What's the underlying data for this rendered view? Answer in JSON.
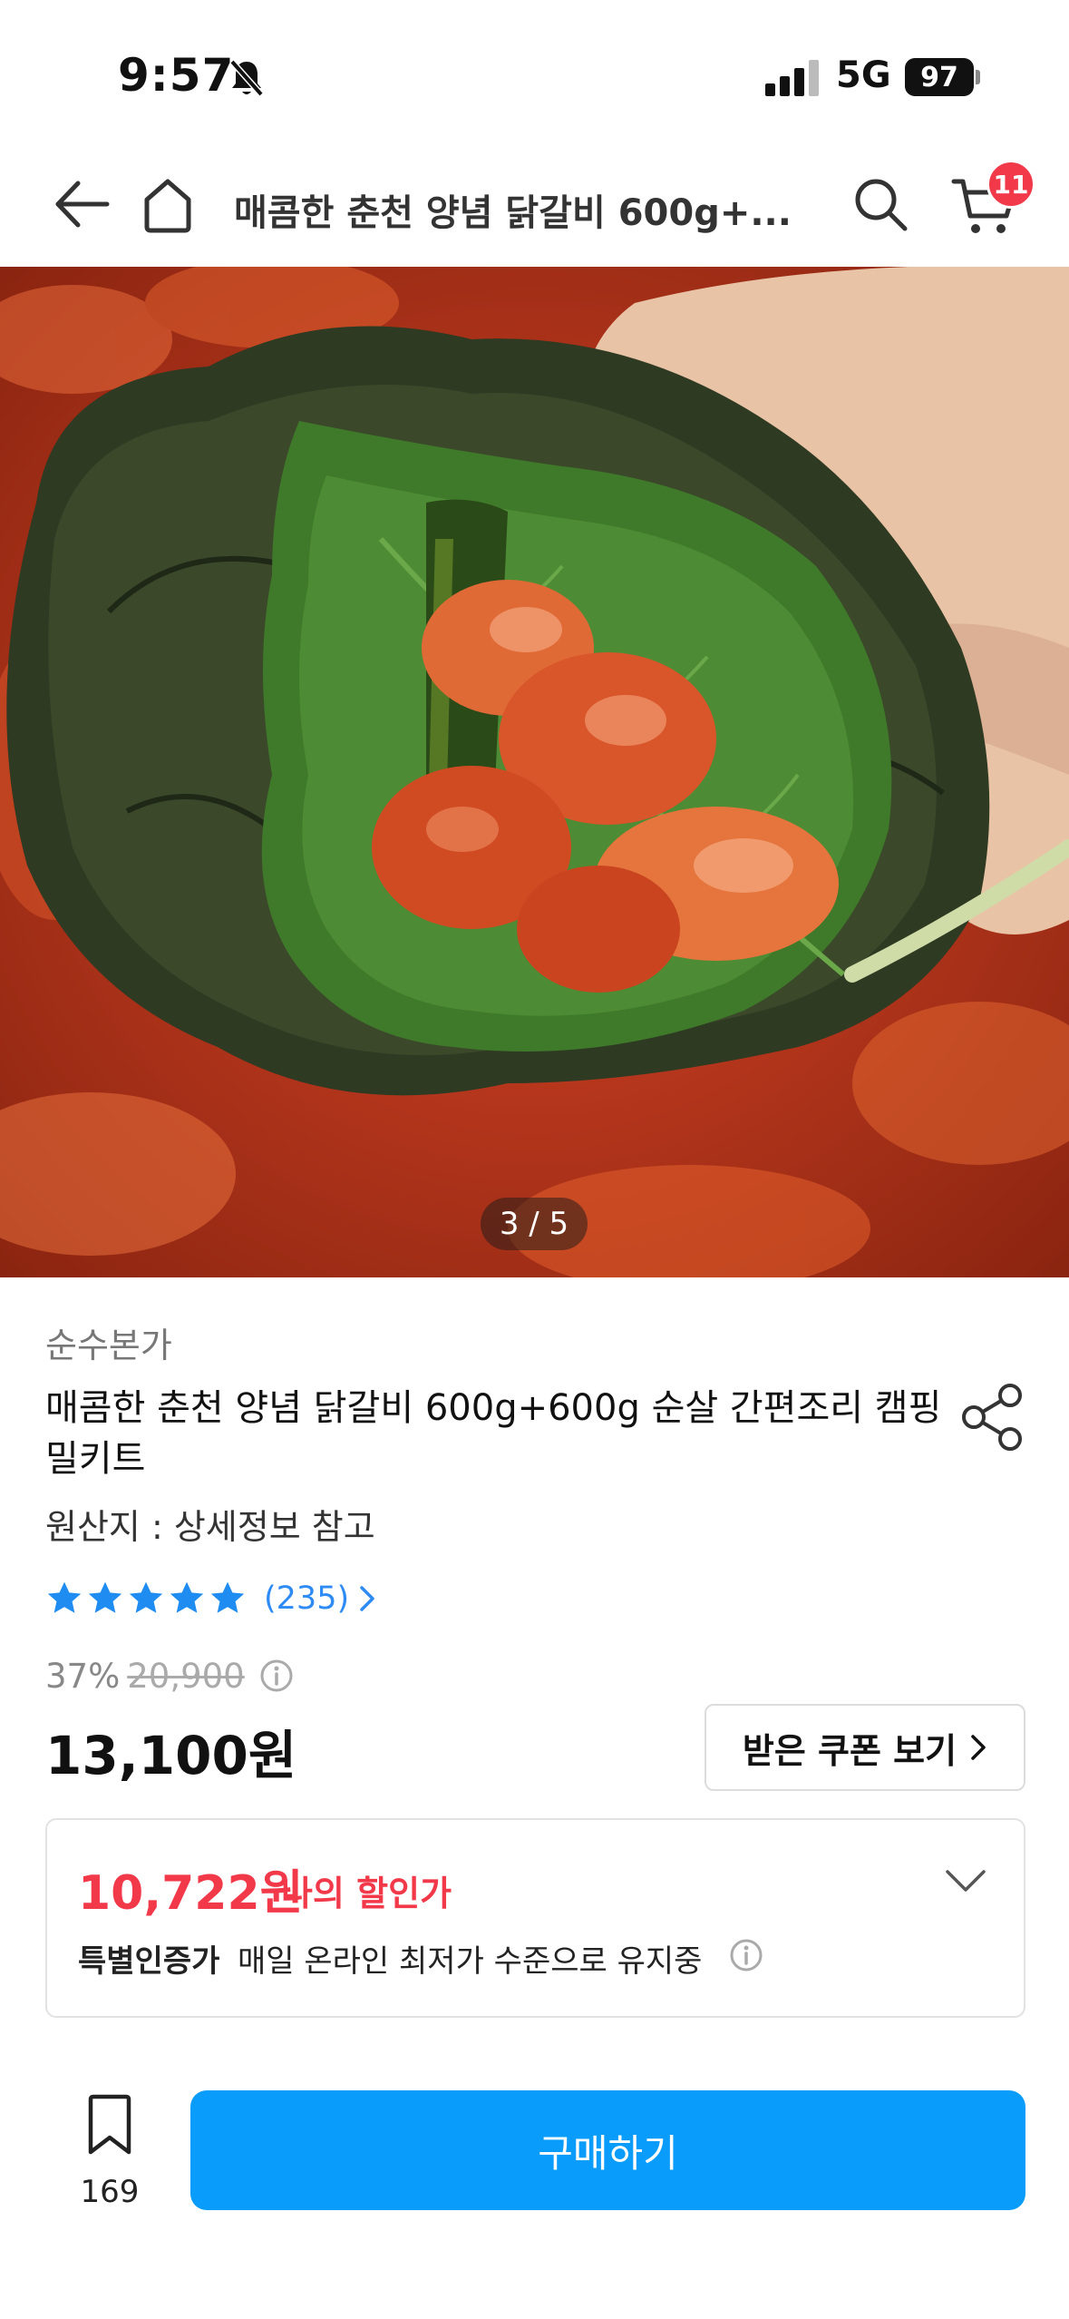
{
  "status_bar": {
    "time": "9:57",
    "network": "5G",
    "battery": "97"
  },
  "header": {
    "title": "매콤한 춘천 양념 닭갈비 600g+...",
    "cart_count": "11"
  },
  "gallery": {
    "counter": "3 / 5"
  },
  "product": {
    "brand": "순수본가",
    "title": "매콤한 춘천 양념 닭갈비 600g+600g 순살 간편조리 캠핑 밀키트",
    "origin": "원산지 : 상세정보 참고",
    "rating_stars": 5,
    "review_count": "(235)",
    "discount_rate": "37%",
    "original_price": "20,900",
    "sale_price": "13,100원",
    "coupon_button": "받은 쿠폰 보기"
  },
  "my_price": {
    "price": "10,722원",
    "label": "나의 할인가",
    "special_label": "특별인증가",
    "special_desc": "매일 온라인 최저가 수준으로 유지중"
  },
  "bottom_bar": {
    "bookmark_count": "169",
    "buy_label": "구매하기"
  },
  "colors": {
    "accent_blue": "#0a9cfb",
    "discount_red": "#f2394a",
    "star_blue": "#1e8cf0"
  }
}
